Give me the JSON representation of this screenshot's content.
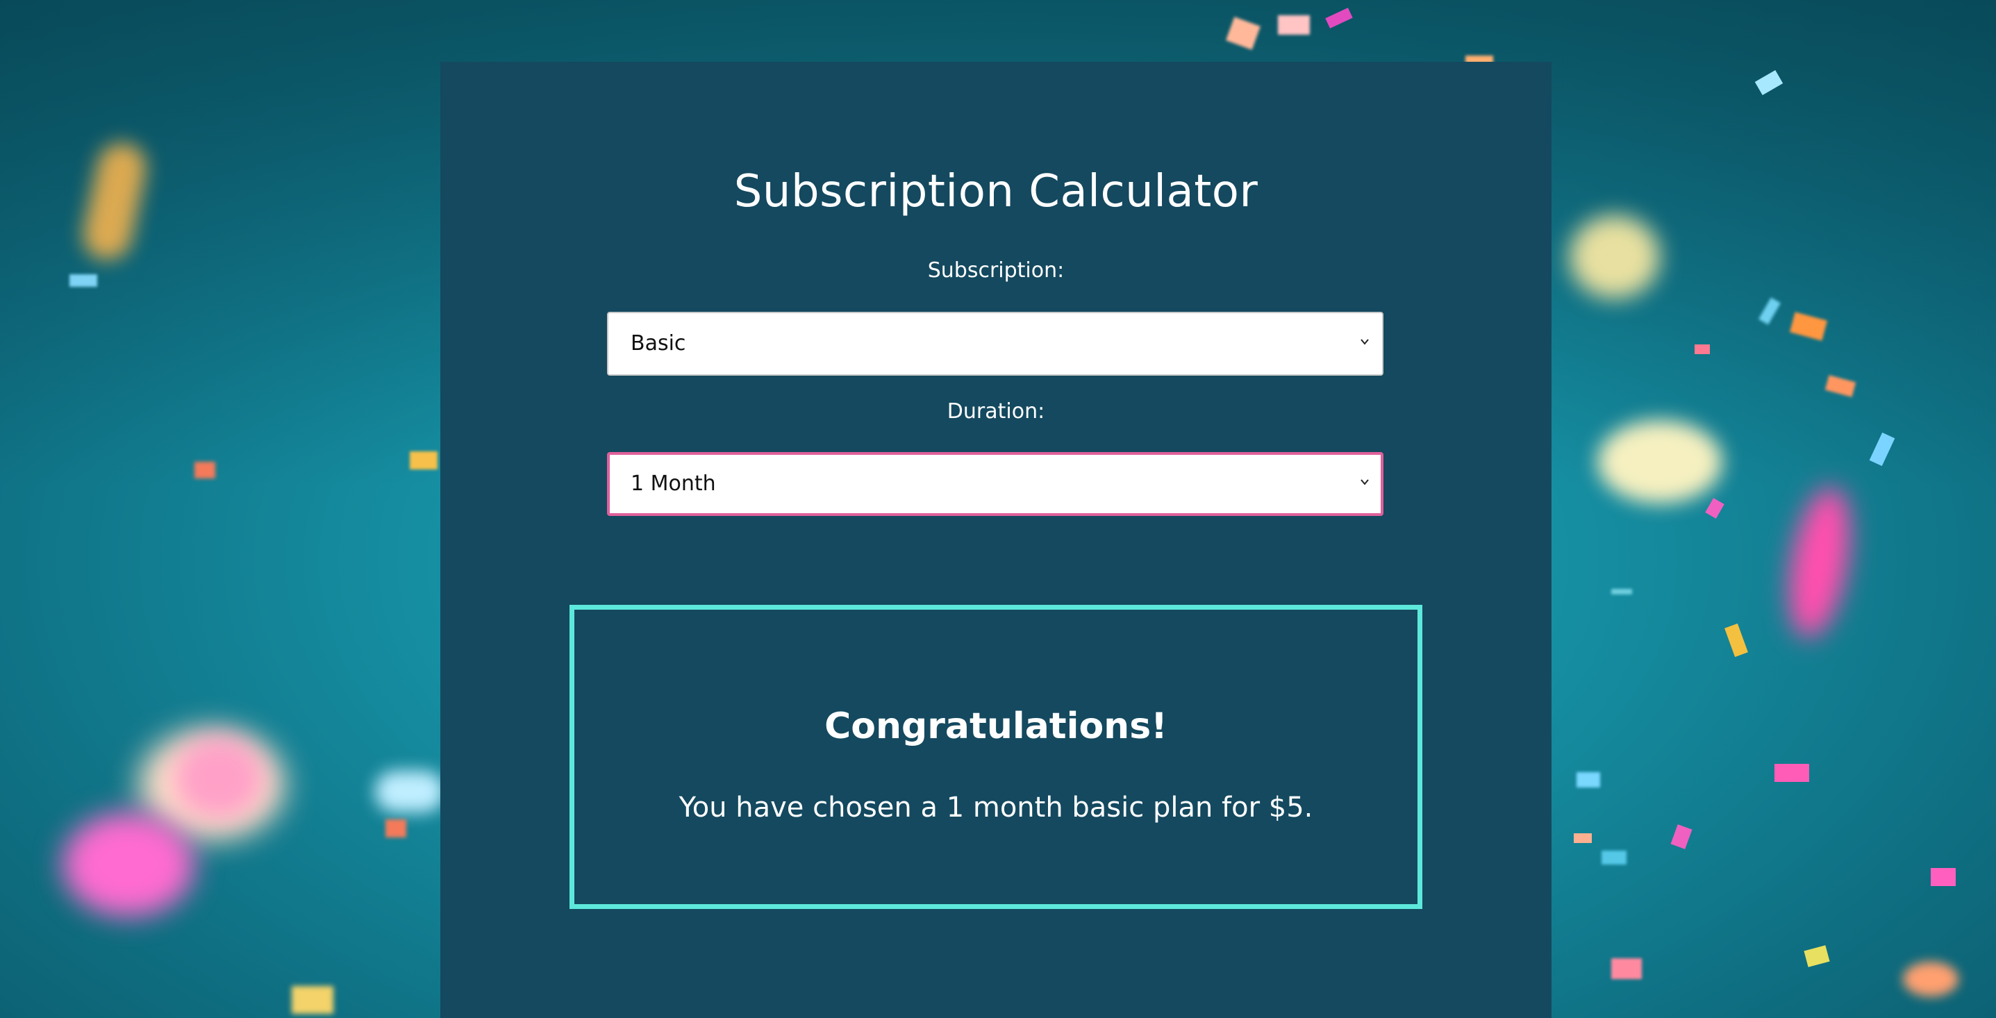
{
  "page": {
    "title": "Subscription Calculator"
  },
  "form": {
    "subscription_label": "Subscription:",
    "subscription_value": "Basic",
    "duration_label": "Duration:",
    "duration_value": "1 Month"
  },
  "result": {
    "heading": "Congratulations!",
    "message": "You have chosen a 1 month basic plan for $5."
  },
  "colors": {
    "panel": "#14495f",
    "result_border": "#5de8dc",
    "focus_border": "#e0609c",
    "background": "#168fa3"
  },
  "icons": {
    "select_arrow": "chevron-down-icon"
  }
}
